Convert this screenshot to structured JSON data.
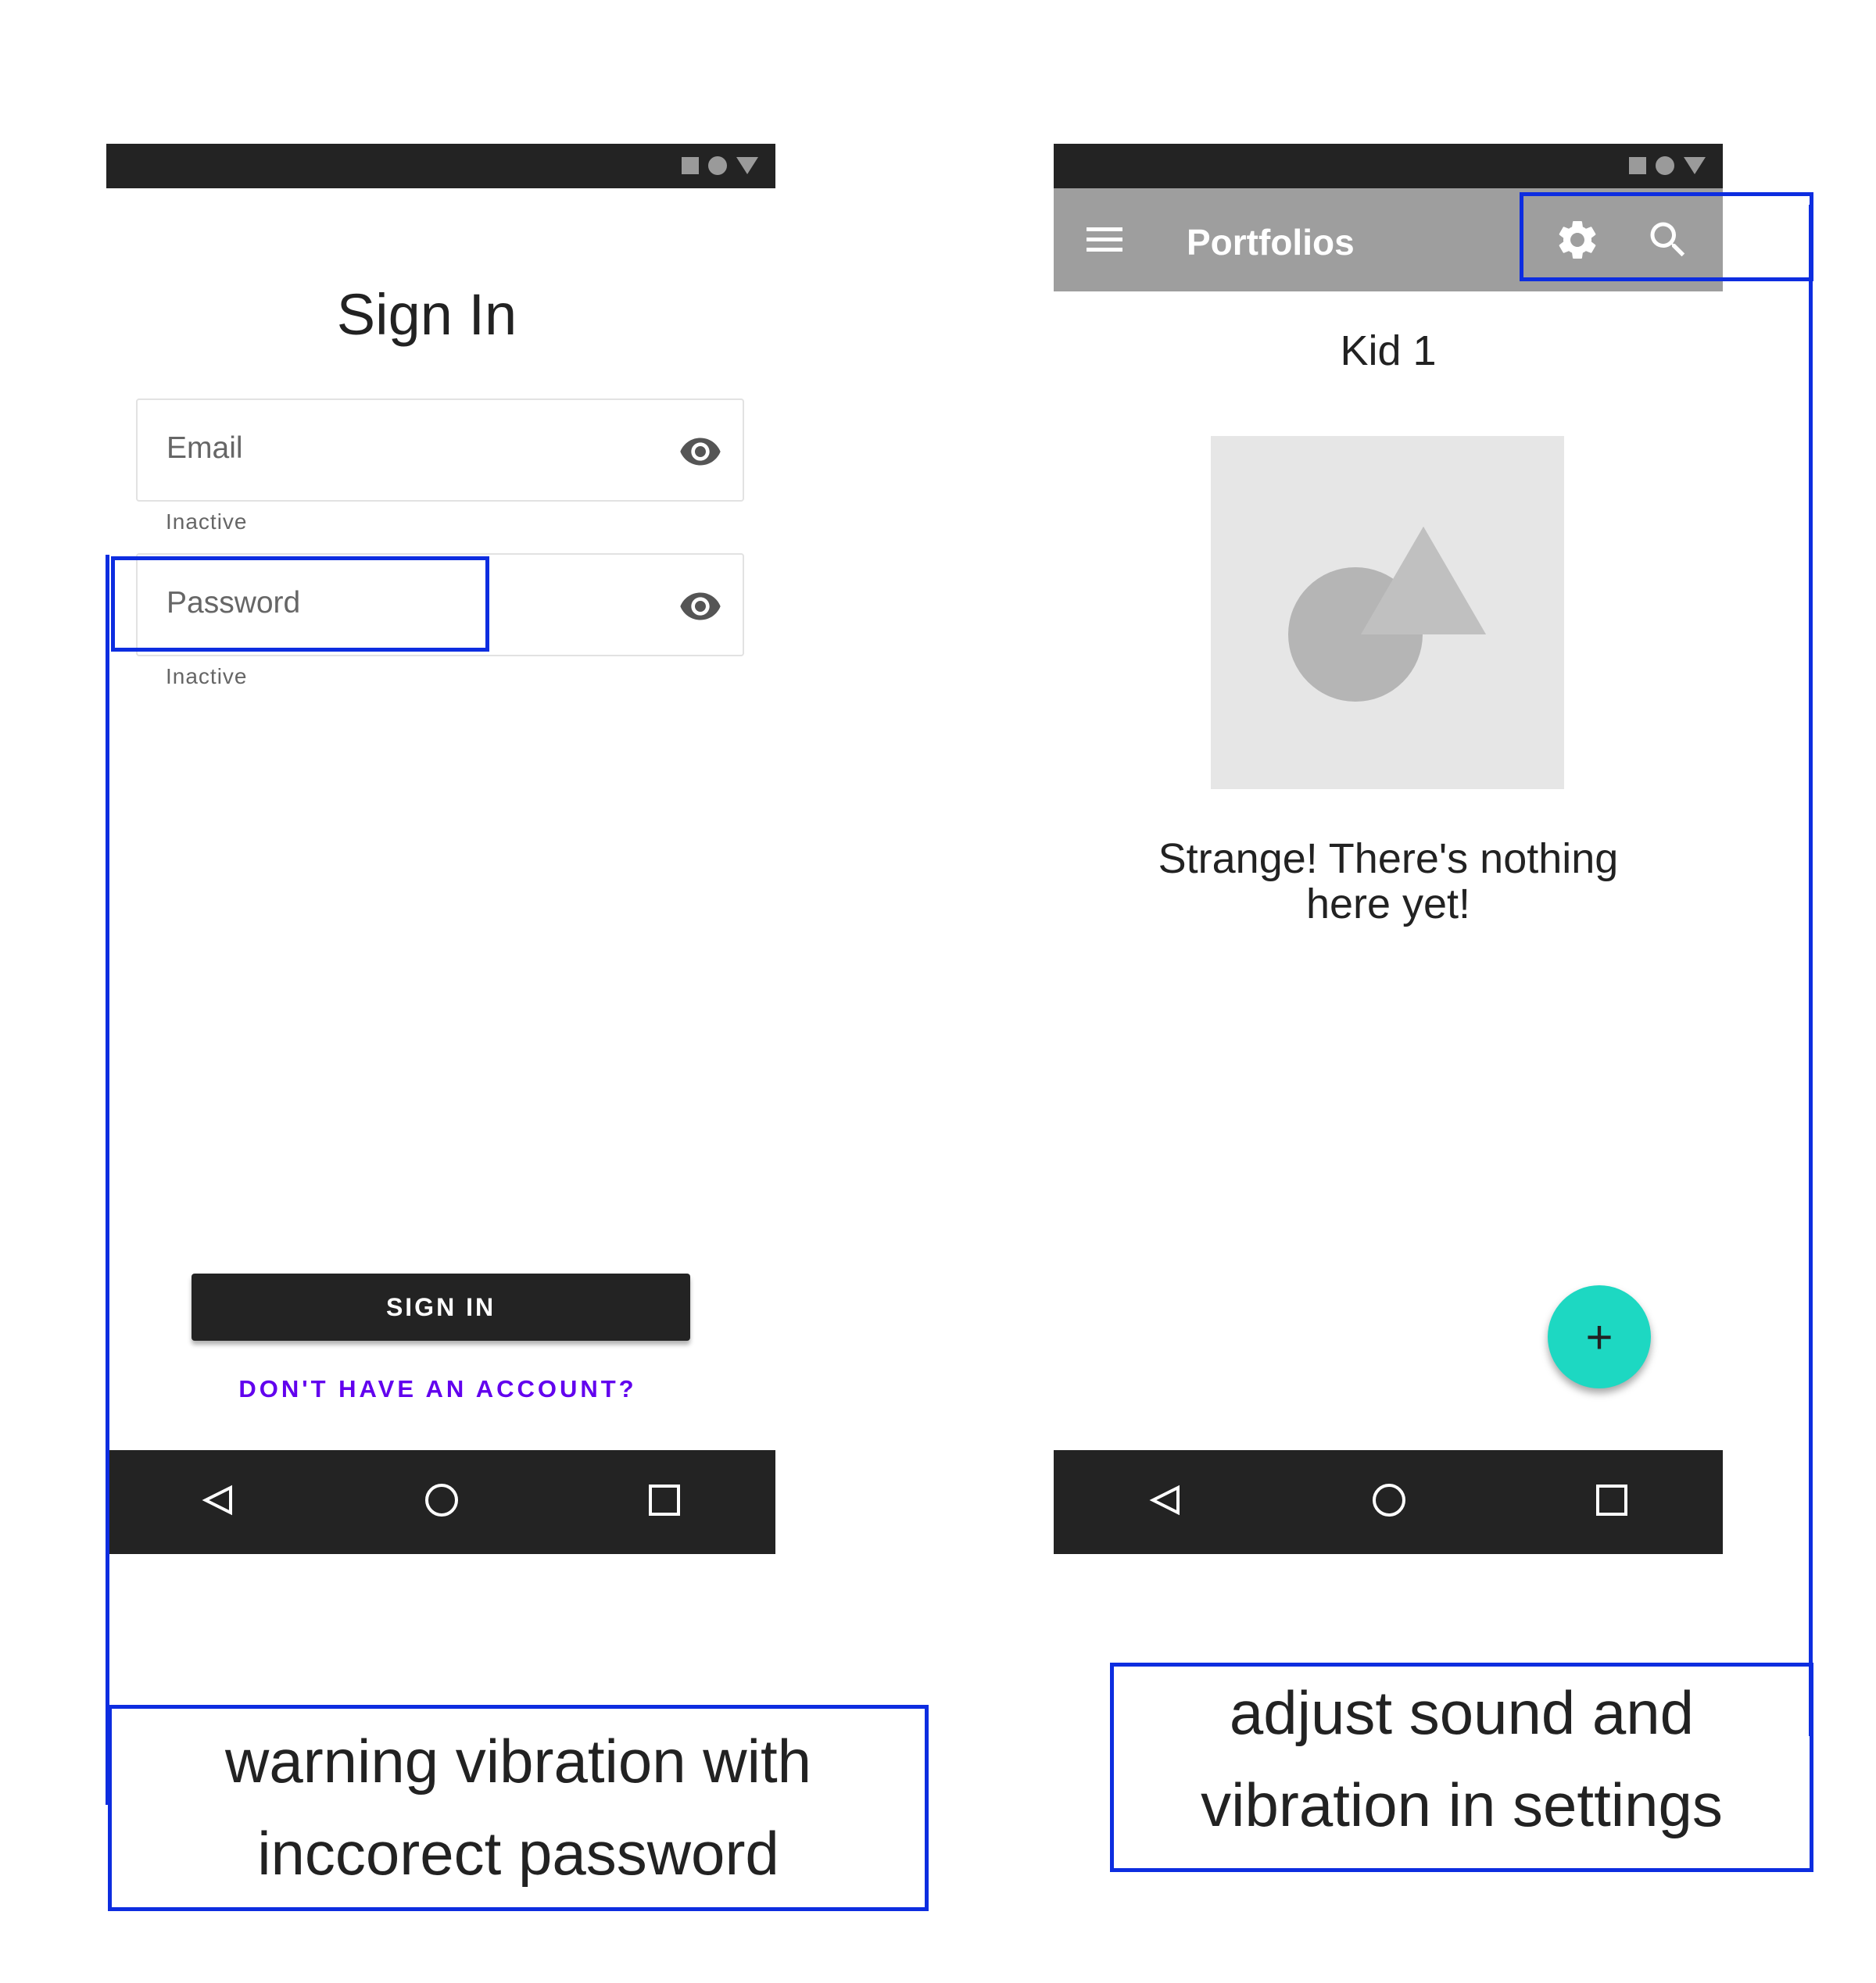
{
  "left_screen": {
    "title": "Sign In",
    "email_label": "Email",
    "email_helper": "Inactive",
    "password_label": "Password",
    "password_helper": "Inactive",
    "signin_button": "SIGN IN",
    "no_account_link": "DON'T HAVE AN ACCOUNT?"
  },
  "right_screen": {
    "appbar_title": "Portfolios",
    "kid_name": "Kid 1",
    "empty_message_line1": "Strange! There's nothing",
    "empty_message_line2": "here yet!",
    "fab_label": "+"
  },
  "annotations": {
    "left_note_line1": "warning vibration with",
    "left_note_line2": "inccorect password",
    "right_note_line1": "adjust sound and",
    "right_note_line2": "vibration in settings"
  },
  "colors": {
    "accent_fab": "#1dd8c2",
    "link": "#6200ee",
    "annotation": "#0d2de0"
  }
}
